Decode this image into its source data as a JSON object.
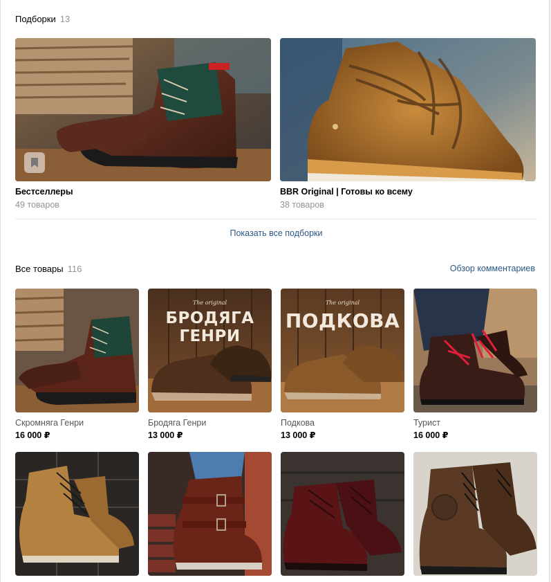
{
  "collections": {
    "title": "Подборки",
    "count": "13",
    "items": [
      {
        "name": "Бестселлеры",
        "subtitle": "49 товаров"
      },
      {
        "name": "BBR Original | Готовы ко всему",
        "subtitle": "38 товаров"
      }
    ],
    "show_all_label": "Показать все подборки"
  },
  "all_products": {
    "title": "Все товары",
    "count": "116",
    "reviews_link": "Обзор комментариев",
    "items": [
      {
        "name": "Скромняга Генри",
        "price": "16 000 ₽"
      },
      {
        "name": "Бродяга Генри",
        "price": "13 000 ₽",
        "banner": "БРОДЯГА ГЕНРИ",
        "banner_small": "The original"
      },
      {
        "name": "Подкова",
        "price": "13 000 ₽",
        "banner": "ПОДКОВА",
        "banner_small": "The original"
      },
      {
        "name": "Турист",
        "price": "16 000 ₽"
      }
    ]
  },
  "colors": {
    "link": "#2a5885",
    "muted": "#939393",
    "background": "#edeef0"
  }
}
